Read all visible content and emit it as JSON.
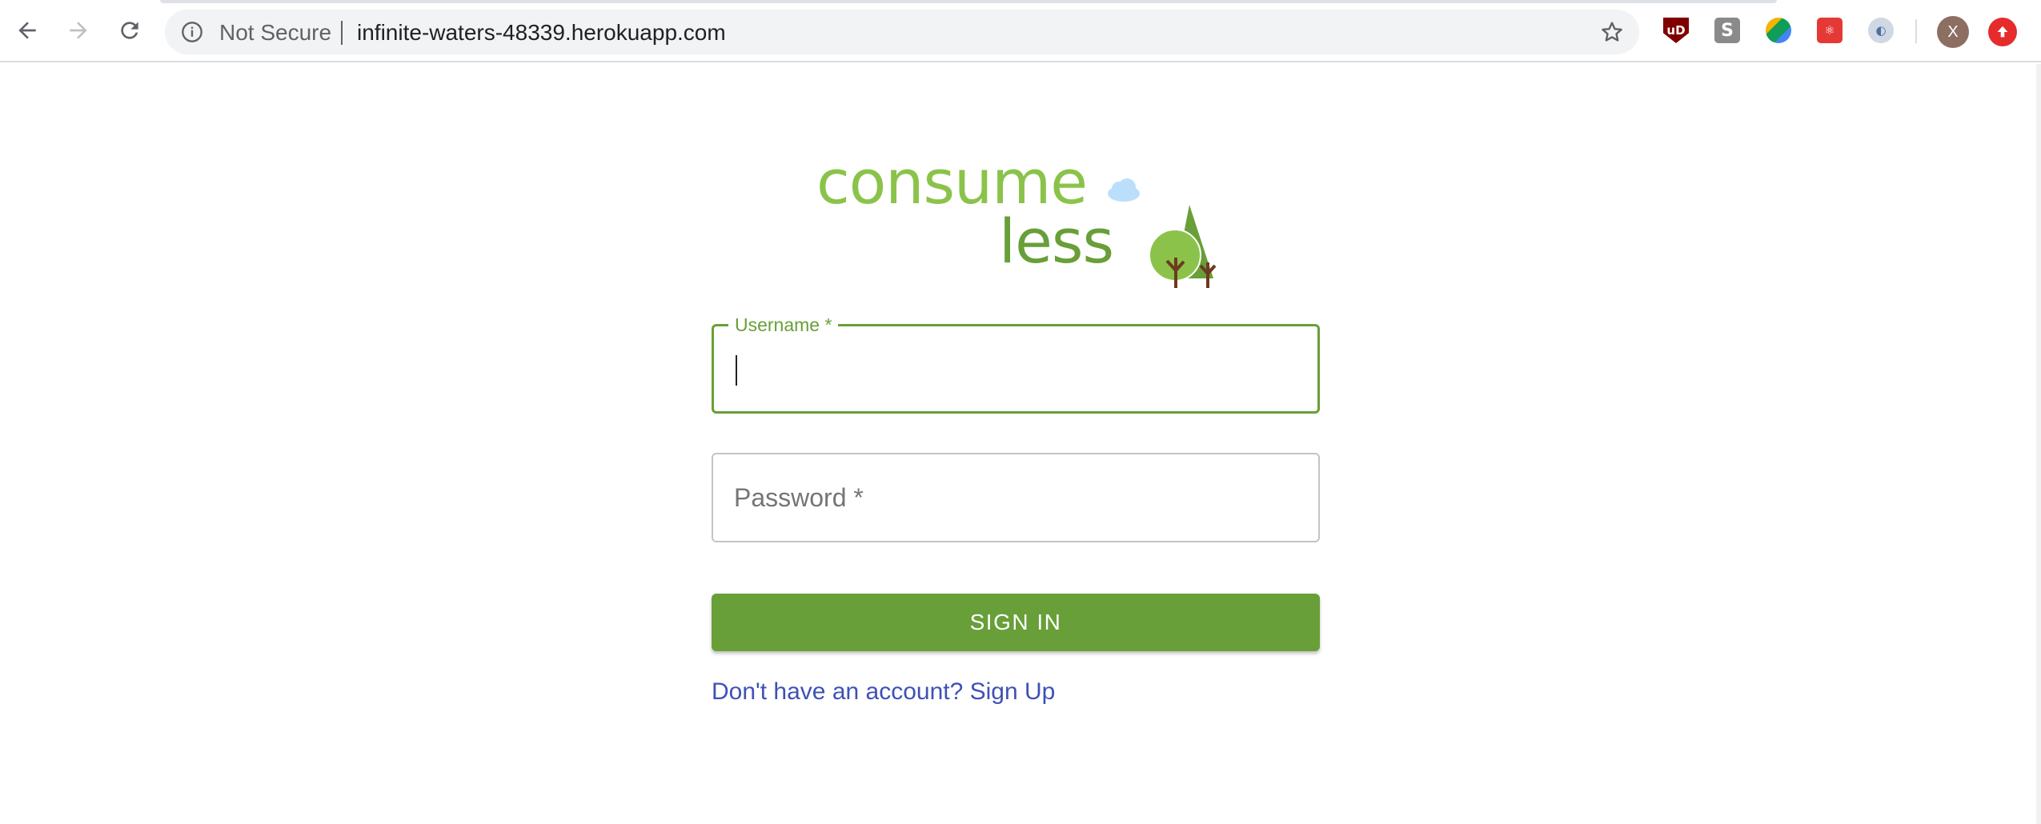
{
  "browser": {
    "security_label": "Not Secure",
    "url": "infinite-waters-48339.herokuapp.com",
    "extensions": [
      {
        "name": "ublock-icon",
        "glyph": "uD"
      },
      {
        "name": "s-extension-icon",
        "glyph": "S"
      },
      {
        "name": "color-extension-icon",
        "glyph": ""
      },
      {
        "name": "react-devtools-icon",
        "glyph": "⚛"
      },
      {
        "name": "blue-extension-icon",
        "glyph": "◐"
      }
    ],
    "profile_initial": "X"
  },
  "logo": {
    "line1": "consume",
    "line2": "less"
  },
  "form": {
    "username_label": "Username *",
    "password_label": "Password *",
    "submit_label": "SIGN IN",
    "signup_link": "Don't have an account? Sign Up"
  },
  "colors": {
    "brand_green": "#689f38",
    "light_green": "#8bc34a",
    "link_blue": "#3f51b5"
  }
}
